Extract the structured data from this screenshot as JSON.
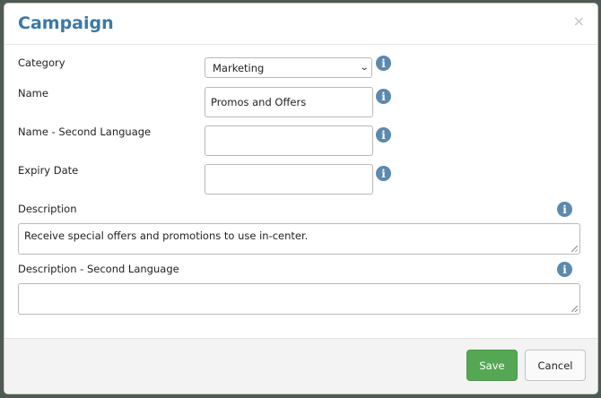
{
  "modal": {
    "title": "Campaign",
    "close_label": "×"
  },
  "fields": {
    "category": {
      "label": "Category",
      "value": "Marketing"
    },
    "name": {
      "label": "Name",
      "value": "Promos and Offers"
    },
    "name_second_language": {
      "label": "Name - Second Language",
      "value": ""
    },
    "expiry_date": {
      "label": "Expiry Date",
      "value": ""
    },
    "description": {
      "label": "Description",
      "value": "Receive special offers and promotions to use in-center."
    },
    "description_second_language": {
      "label": "Description - Second Language",
      "value": ""
    }
  },
  "info_icon_glyph": "i",
  "select_chevron": "⌄",
  "footer": {
    "save_label": "Save",
    "cancel_label": "Cancel"
  },
  "colors": {
    "title": "#3b79a6",
    "info_icon": "#5c89ad",
    "save_button": "#55a754"
  }
}
